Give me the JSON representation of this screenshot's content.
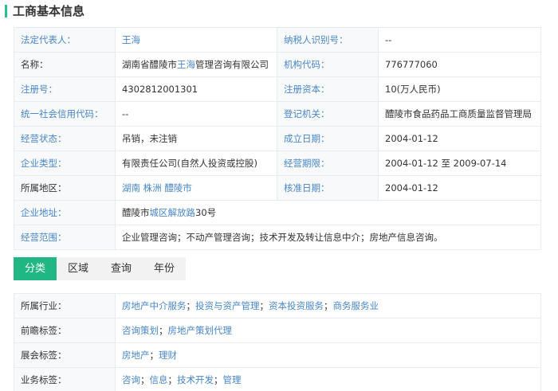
{
  "header": {
    "title": "工商基本信息"
  },
  "info": {
    "legal_rep_label": "法定代表人：",
    "legal_rep_value": "王海",
    "taxpayer_id_label": "纳税人识别号：",
    "taxpayer_id_value": "--",
    "name_label": "名称：",
    "name_prefix": "湖南省醴陵市",
    "name_link": "王海",
    "name_suffix": "管理咨询有限公司",
    "org_code_label": "机构代码：",
    "org_code_value": "776777060",
    "reg_no_label": "注册号：",
    "reg_no_value": "4302812001301",
    "reg_capital_label": "注册资本：",
    "reg_capital_value": "10(万人民币)",
    "credit_code_label": "统一社会信用代码：",
    "credit_code_value": "--",
    "reg_authority_label": "登记机关：",
    "reg_authority_value": "醴陵市食品药品工商质量监督管理局",
    "status_label": "经营状态：",
    "status_value": "吊销，未注销",
    "founded_label": "成立日期：",
    "founded_value": "2004-01-12",
    "type_label": "企业类型：",
    "type_value": "有限责任公司(自然人投资或控股)",
    "term_label": "经营期限：",
    "term_value": "2004-01-12 至 2009-07-14",
    "region_label": "所属地区：",
    "region_1": "湖南",
    "region_2": "株洲",
    "region_3": "醴陵市",
    "approval_label": "核准日期：",
    "approval_value": "2004-01-12",
    "address_label": "企业地址：",
    "address_prefix": "醴陵市",
    "address_link_1": "城区",
    "address_link_2": "解放路",
    "address_suffix": "30号",
    "scope_label": "经营范围：",
    "scope_value": "企业管理咨询；不动产管理咨询；技术开发及转让信息中介；房地产信息咨询。"
  },
  "tabs": [
    "分类",
    "区域",
    "查询",
    "年份"
  ],
  "tags": {
    "industry_label": "所属行业：",
    "industry": [
      "房地产中介服务",
      "投资与资产管理",
      "资本投资服务",
      "商务服务业"
    ],
    "frontier_label": "前瞻标签：",
    "frontier": [
      "咨询策划",
      "房地产策划代理"
    ],
    "expo_label": "展会标签：",
    "expo": [
      "房地产",
      "理财"
    ],
    "business_label": "业务标签：",
    "business": [
      "咨询",
      "信息",
      "技术开发",
      "管理"
    ],
    "separator": "；"
  },
  "colors": {
    "accent_green": "#21b784",
    "link_blue": "#4a86c6",
    "border": "#e6ecf0"
  }
}
